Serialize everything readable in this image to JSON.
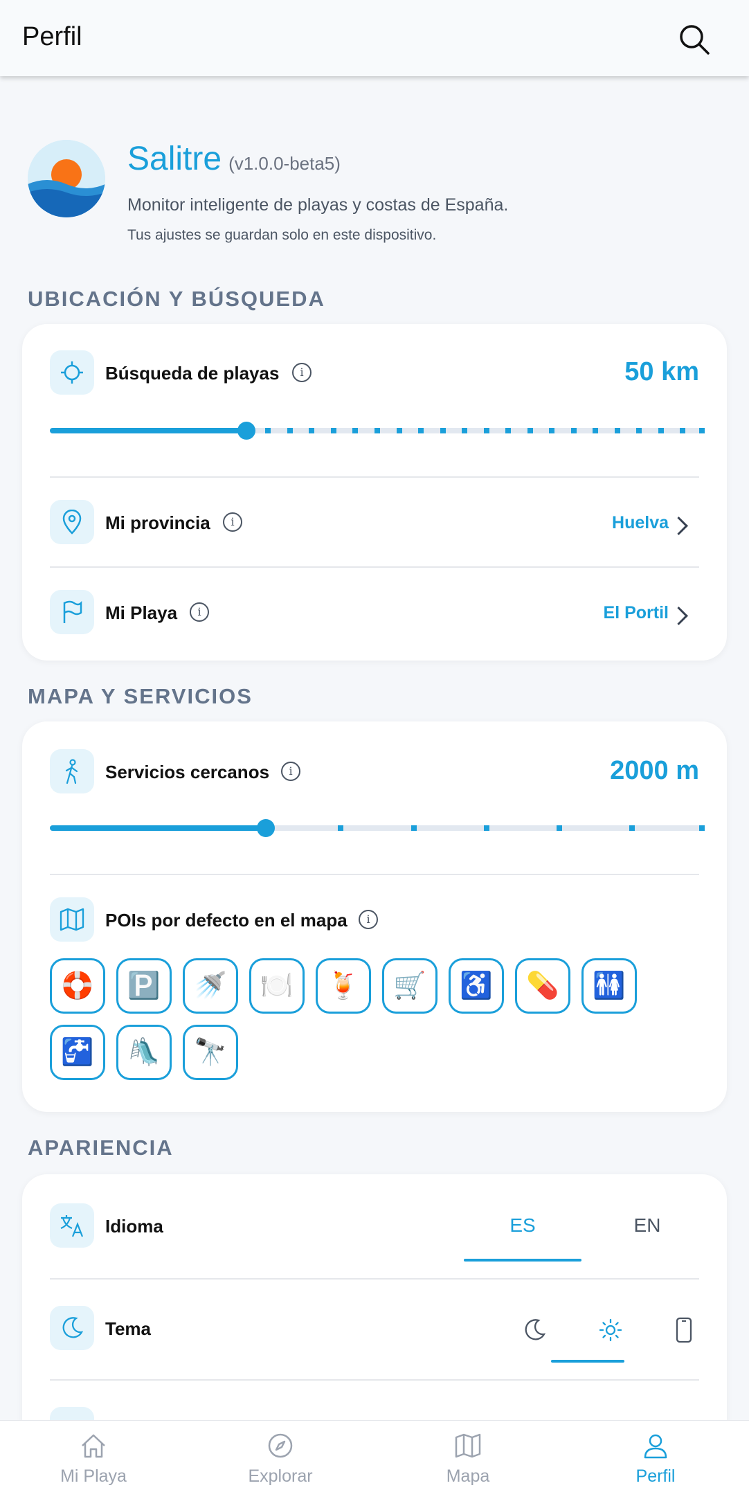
{
  "header": {
    "title": "Perfil",
    "search_icon": "search-icon"
  },
  "app": {
    "name": "Salitre",
    "version": "(v1.0.0-beta5)",
    "description": "Monitor inteligente de playas y costas de España.",
    "note": "Tus ajustes se guardan solo en este dispositivo.",
    "logo_icon": "sun-over-sea-logo"
  },
  "sections": {
    "location": {
      "title": "UBICACIÓN Y BÚSQUEDA",
      "search": {
        "label": "Búsqueda de playas",
        "value": "50 km",
        "slider_fraction": 0.3,
        "icon": "crosshair-icon"
      },
      "province": {
        "label": "Mi provincia",
        "value": "Huelva",
        "icon": "map-pin-icon"
      },
      "beach": {
        "label": "Mi Playa",
        "value": "El Portil",
        "icon": "flag-icon"
      }
    },
    "map": {
      "title": "MAPA Y SERVICIOS",
      "nearby": {
        "label": "Servicios cercanos",
        "value": "2000 m",
        "slider_fraction": 0.33,
        "icon": "walking-icon"
      },
      "pois": {
        "label": "POIs por defecto en el mapa",
        "icon": "map-icon",
        "items": [
          {
            "name": "lifebuoy",
            "glyph": "🛟"
          },
          {
            "name": "parking",
            "glyph": "🅿️"
          },
          {
            "name": "shower",
            "glyph": "🚿"
          },
          {
            "name": "restaurant",
            "glyph": "🍽️"
          },
          {
            "name": "bar",
            "glyph": "🍹"
          },
          {
            "name": "shop",
            "glyph": "🛒"
          },
          {
            "name": "accessibility",
            "glyph": "♿"
          },
          {
            "name": "pharmacy",
            "glyph": "💊"
          },
          {
            "name": "toilets",
            "glyph": "🚻"
          },
          {
            "name": "drinking-water",
            "glyph": "🚰"
          },
          {
            "name": "playground",
            "glyph": "🛝"
          },
          {
            "name": "viewpoint",
            "glyph": "🔭"
          }
        ]
      }
    },
    "appearance": {
      "title": "APARIENCIA",
      "language": {
        "label": "Idioma",
        "options": [
          "ES",
          "EN"
        ],
        "selected": "ES",
        "icon": "translate-icon"
      },
      "theme": {
        "label": "Tema",
        "options": [
          "moon-icon",
          "sun-icon",
          "phone-icon"
        ],
        "selected": "sun-icon",
        "icon": "moon-icon"
      }
    }
  },
  "bottom_nav": {
    "items": [
      {
        "label": "Mi Playa",
        "icon": "home-icon",
        "active": false
      },
      {
        "label": "Explorar",
        "icon": "compass-icon",
        "active": false
      },
      {
        "label": "Mapa",
        "icon": "map-icon",
        "active": false
      },
      {
        "label": "Perfil",
        "icon": "user-icon",
        "active": true
      }
    ]
  },
  "colors": {
    "accent": "#1a9fda",
    "section_title": "#64748b",
    "background": "#f5f7fa"
  }
}
